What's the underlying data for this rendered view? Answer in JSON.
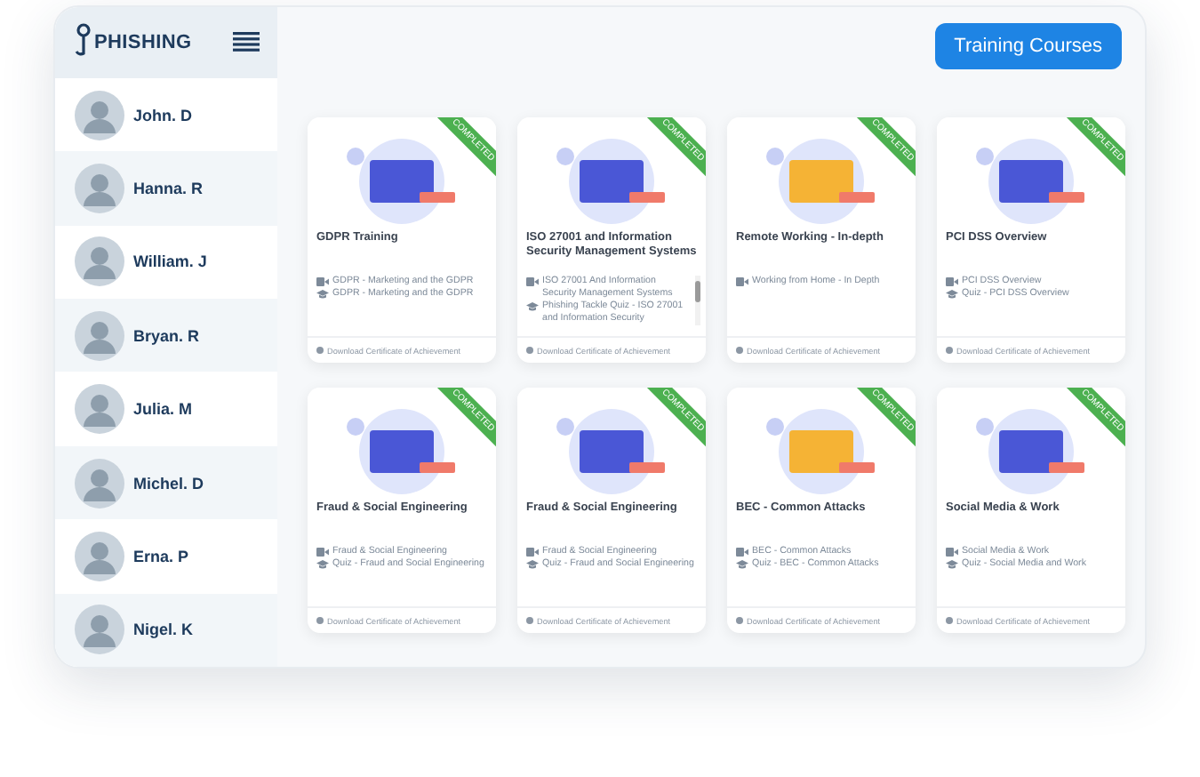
{
  "logo": {
    "text": "PHISHING"
  },
  "header": {
    "button": "Training Courses"
  },
  "people": [
    {
      "name": "John. D"
    },
    {
      "name": "Hanna. R"
    },
    {
      "name": "William. J"
    },
    {
      "name": "Bryan. R"
    },
    {
      "name": "Julia. M"
    },
    {
      "name": "Michel. D"
    },
    {
      "name": "Erna. P"
    },
    {
      "name": "Nigel. K"
    }
  ],
  "courses": [
    {
      "title": "GDPR Training",
      "badge": "COMPLETED",
      "scrollable": false,
      "items": [
        {
          "kind": "video",
          "text": "GDPR - Marketing and the GDPR"
        },
        {
          "kind": "quiz",
          "text": "GDPR - Marketing and the GDPR"
        }
      ],
      "footer": "Download Certificate of Achievement"
    },
    {
      "title": "ISO 27001 and Information Security Management Systems",
      "badge": "COMPLETED",
      "scrollable": true,
      "items": [
        {
          "kind": "video",
          "text": "ISO 27001 And Information Security Management Systems"
        },
        {
          "kind": "quiz",
          "text": "Phishing Tackle Quiz - ISO 27001 and Information Security"
        }
      ],
      "footer": "Download Certificate of Achievement"
    },
    {
      "title": "Remote Working - In-depth",
      "badge": "COMPLETED",
      "scrollable": false,
      "items": [
        {
          "kind": "video",
          "text": "Working from Home - In Depth"
        }
      ],
      "footer": "Download Certificate of Achievement"
    },
    {
      "title": "PCI DSS Overview",
      "badge": "COMPLETED",
      "scrollable": false,
      "items": [
        {
          "kind": "video",
          "text": "PCI DSS Overview"
        },
        {
          "kind": "quiz",
          "text": "Quiz - PCI DSS Overview"
        }
      ],
      "footer": "Download Certificate of Achievement"
    },
    {
      "title": "Fraud & Social Engineering",
      "badge": "COMPLETED",
      "scrollable": false,
      "items": [
        {
          "kind": "video",
          "text": "Fraud & Social Engineering"
        },
        {
          "kind": "quiz",
          "text": "Quiz - Fraud and Social Engineering"
        }
      ],
      "footer": "Download Certificate of Achievement"
    },
    {
      "title": "Fraud & Social Engineering",
      "badge": "COMPLETED",
      "scrollable": false,
      "items": [
        {
          "kind": "video",
          "text": "Fraud & Social Engineering"
        },
        {
          "kind": "quiz",
          "text": "Quiz - Fraud and Social Engineering"
        }
      ],
      "footer": "Download Certificate of Achievement"
    },
    {
      "title": "BEC - Common Attacks",
      "badge": "COMPLETED",
      "scrollable": false,
      "items": [
        {
          "kind": "video",
          "text": "BEC - Common Attacks"
        },
        {
          "kind": "quiz",
          "text": "Quiz - BEC - Common Attacks"
        }
      ],
      "footer": "Download Certificate of Achievement"
    },
    {
      "title": "Social Media & Work",
      "badge": "COMPLETED",
      "scrollable": false,
      "items": [
        {
          "kind": "video",
          "text": "Social Media & Work"
        },
        {
          "kind": "quiz",
          "text": "Quiz - Social Media and Work"
        }
      ],
      "footer": "Download Certificate of Achievement"
    }
  ]
}
